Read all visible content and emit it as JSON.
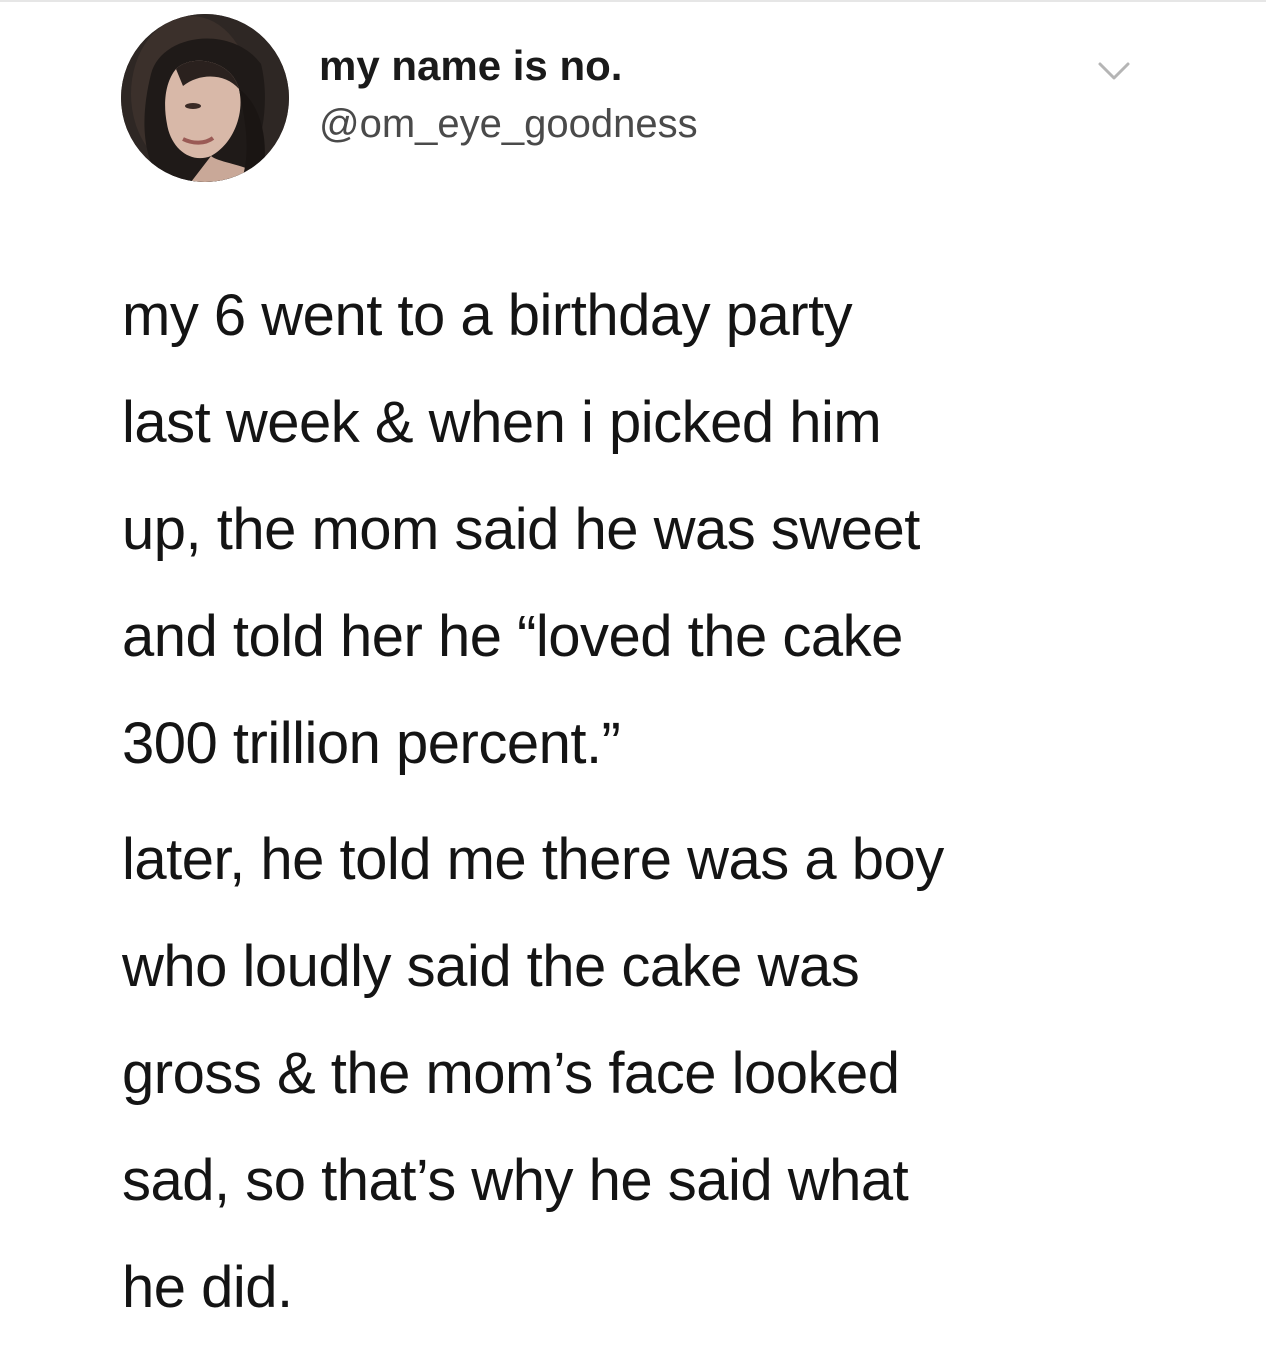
{
  "tweet": {
    "author": {
      "display_name": "my name is no.",
      "handle": "@om_eye_goodness",
      "avatar_icon": "profile-photo"
    },
    "menu_icon": "chevron-down-icon",
    "paragraphs": [
      [
        "my 6 went to a birthday party",
        "last week & when i picked him",
        "up, the mom said he was sweet",
        "and told her he “loved the cake",
        "300 trillion percent.”"
      ],
      [
        "later, he told me there was a boy",
        "who loudly said the cake was",
        "gross & the mom’s face looked",
        "sad, so that’s why he said what",
        "he did."
      ]
    ]
  },
  "colors": {
    "text": "#141414",
    "handle": "#4a4a4a",
    "caret": "#b5b5b5",
    "background": "#ffffff"
  }
}
